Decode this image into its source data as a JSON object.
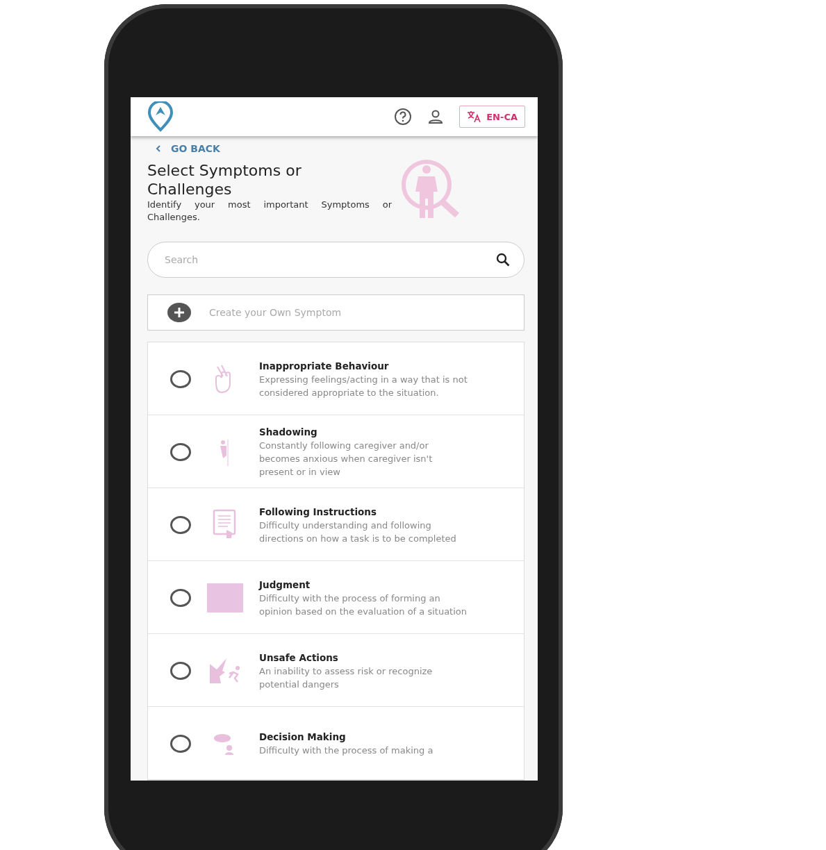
{
  "header": {
    "language": "EN-CA"
  },
  "back_link": {
    "label": "GO BACK"
  },
  "title": "Select Symptoms or Challenges",
  "subtitle": "Identify your most important Symptoms or Challenges.",
  "search": {
    "placeholder": "Search"
  },
  "create_button": {
    "label": "Create your Own Symptom"
  },
  "symptoms": [
    {
      "title": "Inappropriate Behaviour",
      "description": "Expressing feelings/acting in a way that is not considered appropriate to the situation.",
      "selected": false
    },
    {
      "title": "Shadowing",
      "description": "Constantly following caregiver and/or becomes anxious when caregiver isn't present or in view",
      "selected": false
    },
    {
      "title": "Following Instructions",
      "description": "Difficulty understanding and following directions on how a task is to be completed",
      "selected": false
    },
    {
      "title": "Judgment",
      "description": "Difficulty with the process of forming an opinion based on the evaluation of a situation",
      "selected": false
    },
    {
      "title": "Unsafe Actions",
      "description": "An inability to assess risk or recognize potential dangers",
      "selected": false
    },
    {
      "title": "Decision Making",
      "description": "Difficulty with the process of making a",
      "selected": false
    }
  ]
}
